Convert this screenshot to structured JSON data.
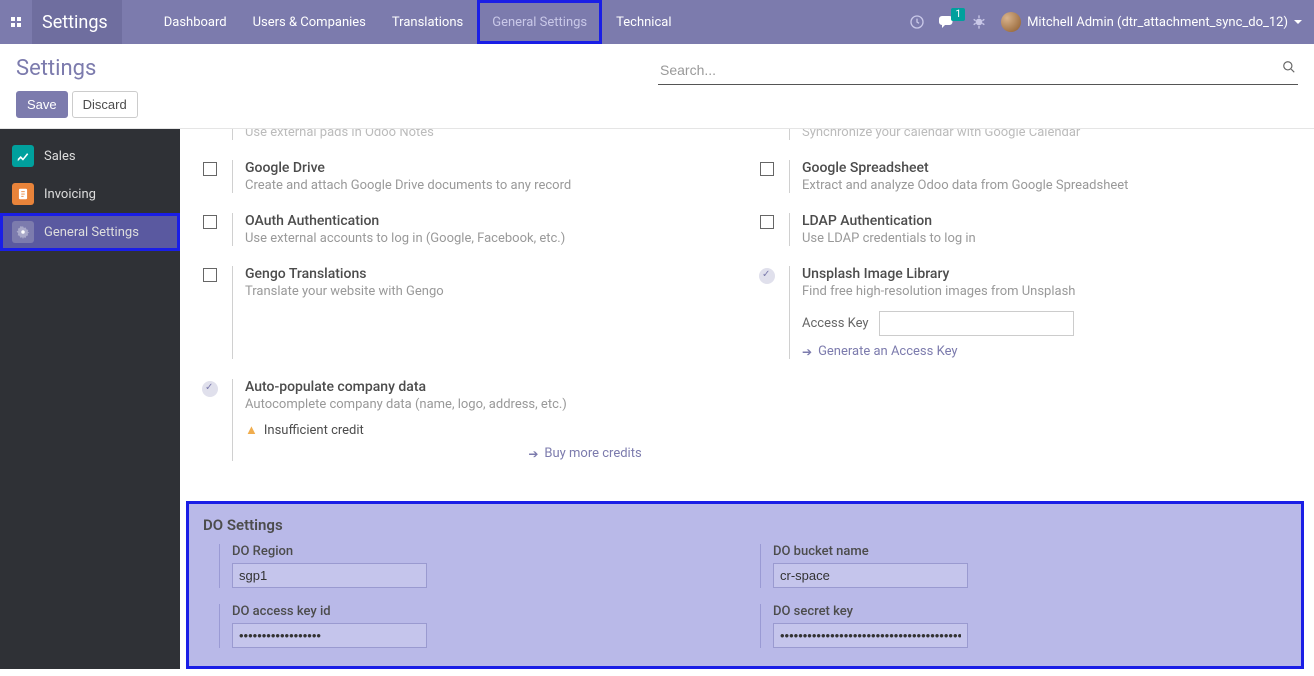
{
  "nav": {
    "brand": "Settings",
    "items": [
      "Dashboard",
      "Users & Companies",
      "Translations",
      "General Settings",
      "Technical"
    ],
    "messaging_badge": "1",
    "user": "Mitchell Admin (dtr_attachment_sync_do_12)"
  },
  "control": {
    "title": "Settings",
    "save": "Save",
    "discard": "Discard",
    "search_placeholder": "Search..."
  },
  "sidebar": {
    "items": [
      {
        "label": "Sales"
      },
      {
        "label": "Invoicing"
      },
      {
        "label": "General Settings"
      }
    ]
  },
  "settings": {
    "row0_left_desc": "Use external pads in Odoo Notes",
    "row0_right_desc": "Synchronize your calendar with Google Calendar",
    "gdrive_title": "Google Drive",
    "gdrive_desc": "Create and attach Google Drive documents to any record",
    "gsheet_title": "Google Spreadsheet",
    "gsheet_desc": "Extract and analyze Odoo data from Google Spreadsheet",
    "oauth_title": "OAuth Authentication",
    "oauth_desc": "Use external accounts to log in (Google, Facebook, etc.)",
    "ldap_title": "LDAP Authentication",
    "ldap_desc": "Use LDAP credentials to log in",
    "gengo_title": "Gengo Translations",
    "gengo_desc": "Translate your website with Gengo",
    "unsplash_title": "Unsplash Image Library",
    "unsplash_desc": "Find free high-resolution images from Unsplash",
    "unsplash_access_label": "Access Key",
    "unsplash_link": "Generate an Access Key",
    "auto_title": "Auto-populate company data",
    "auto_desc": "Autocomplete company data (name, logo, address, etc.)",
    "auto_warn": "Insufficient credit",
    "auto_link": "Buy more credits"
  },
  "do": {
    "header": "DO Settings",
    "region_label": "DO Region",
    "region_value": "sgp1",
    "bucket_label": "DO bucket name",
    "bucket_value": "cr-space",
    "access_label": "DO access key id",
    "access_value": "••••••••••••••••••",
    "secret_label": "DO secret key",
    "secret_value": "••••••••••••••••••••••••••••••••••••••••••••"
  }
}
